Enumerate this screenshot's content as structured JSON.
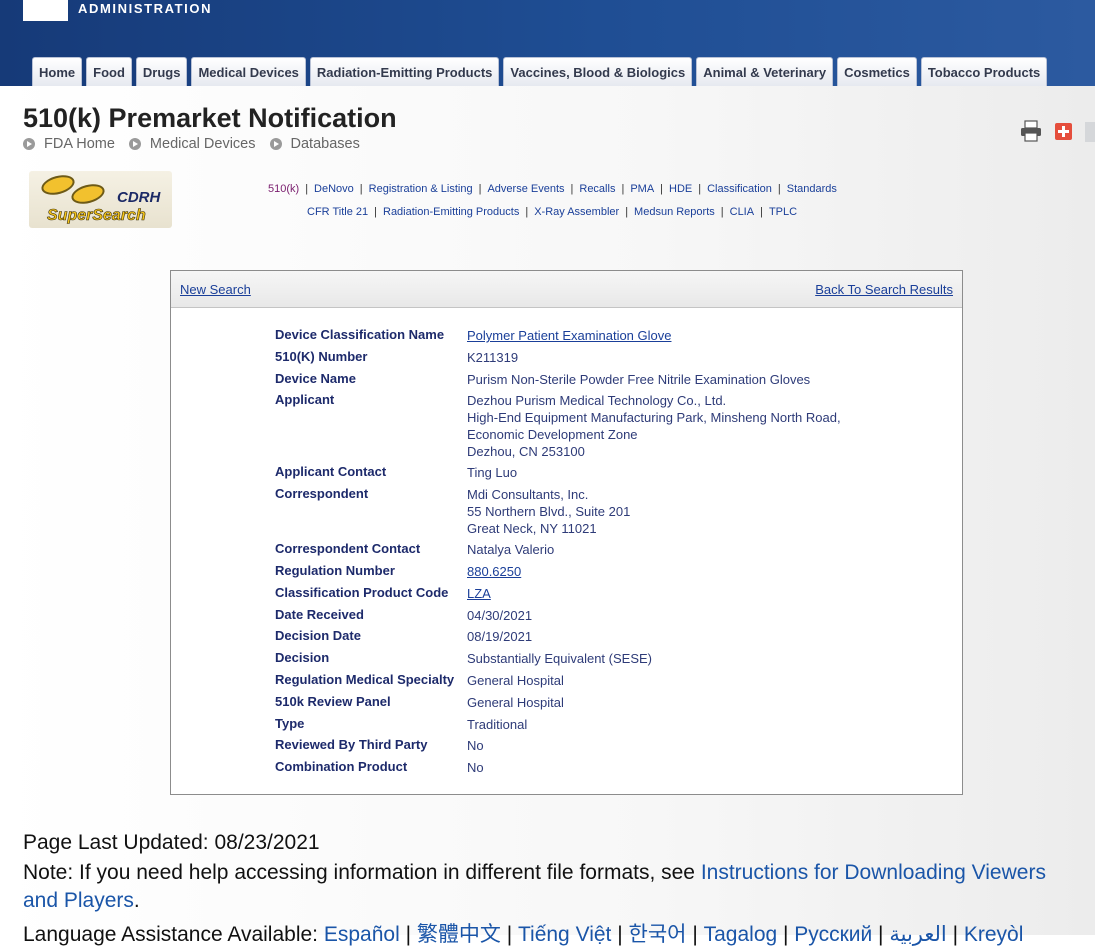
{
  "header": {
    "agency_name": "ADMINISTRATION",
    "nav_tabs": [
      "Home",
      "Food",
      "Drugs",
      "Medical Devices",
      "Radiation-Emitting Products",
      "Vaccines, Blood & Biologics",
      "Animal & Veterinary",
      "Cosmetics",
      "Tobacco Products"
    ]
  },
  "page": {
    "title": "510(k) Premarket Notification",
    "breadcrumb": [
      "FDA Home",
      "Medical Devices",
      "Databases"
    ]
  },
  "logo": {
    "line1": "CDRH",
    "line2": "SuperSearch"
  },
  "db_links": {
    "line1": [
      "510(k)",
      "DeNovo",
      "Registration & Listing",
      "Adverse Events",
      "Recalls",
      "PMA",
      "HDE",
      "Classification",
      "Standards"
    ],
    "line2": [
      "CFR Title 21",
      "Radiation-Emitting Products",
      "X-Ray Assembler",
      "Medsun Reports",
      "CLIA",
      "TPLC"
    ]
  },
  "panel": {
    "new_search": "New Search",
    "back_to_results": "Back To Search Results",
    "fields": [
      {
        "label": "Device Classification Name",
        "value": [
          "Polymer Patient Examination Glove"
        ],
        "link": true
      },
      {
        "label": "510(K) Number",
        "value": [
          "K211319"
        ],
        "link": false
      },
      {
        "label": "Device Name",
        "value": [
          "Purism Non-Sterile Powder Free Nitrile Examination Gloves"
        ],
        "link": false
      },
      {
        "label": "Applicant",
        "value": [
          "Dezhou Purism Medical Technology Co., Ltd.",
          "High-End Equipment Manufacturing Park, Minsheng North Road,",
          "Economic Development Zone",
          "Dezhou,  CN 253100"
        ],
        "link": false
      },
      {
        "label": "Applicant Contact",
        "value": [
          "Ting Luo"
        ],
        "link": false
      },
      {
        "label": "Correspondent",
        "value": [
          "Mdi Consultants, Inc.",
          "55 Northern Blvd., Suite 201",
          "Great Neck,  NY  11021"
        ],
        "link": false
      },
      {
        "label": "Correspondent Contact",
        "value": [
          "Natalya Valerio"
        ],
        "link": false
      },
      {
        "label": "Regulation Number",
        "value": [
          "880.6250"
        ],
        "link": true
      },
      {
        "label": "Classification Product Code",
        "value": [
          "LZA"
        ],
        "link": true
      },
      {
        "label": "Date Received",
        "value": [
          "04/30/2021"
        ],
        "link": false
      },
      {
        "label": "Decision Date",
        "value": [
          "08/19/2021"
        ],
        "link": false
      },
      {
        "label": "Decision",
        "value": [
          "Substantially Equivalent (SESE)"
        ],
        "link": false
      },
      {
        "label": "Regulation Medical Specialty",
        "value": [
          "General Hospital"
        ],
        "link": false
      },
      {
        "label": "510k Review Panel",
        "value": [
          "General Hospital"
        ],
        "link": false
      },
      {
        "label": "Type",
        "value": [
          "Traditional"
        ],
        "link": false
      },
      {
        "label": "Reviewed By Third Party",
        "value": [
          "No"
        ],
        "link": false
      },
      {
        "label": "Combination Product",
        "value": [
          "No"
        ],
        "link": false
      }
    ]
  },
  "footer": {
    "last_updated": "Page Last Updated: 08/23/2021",
    "note_text": "Note: If you need help accessing information in different file formats, see ",
    "note_link": "Instructions for Downloading Viewers and Players",
    "note_end": ".",
    "lang_prefix": "Language Assistance Available: ",
    "languages": [
      "Español",
      "繁體中文",
      "Tiếng Việt",
      "한국어",
      "Tagalog",
      "Русский",
      "العربية",
      "Kreyòl"
    ]
  },
  "icons": {
    "print": "printer-icon",
    "share": "plus-share-icon",
    "email": "email-icon"
  },
  "colors": {
    "header_blue": "#1f4e94",
    "link_blue": "#1a3f99",
    "label_navy": "#1d2a6b"
  }
}
